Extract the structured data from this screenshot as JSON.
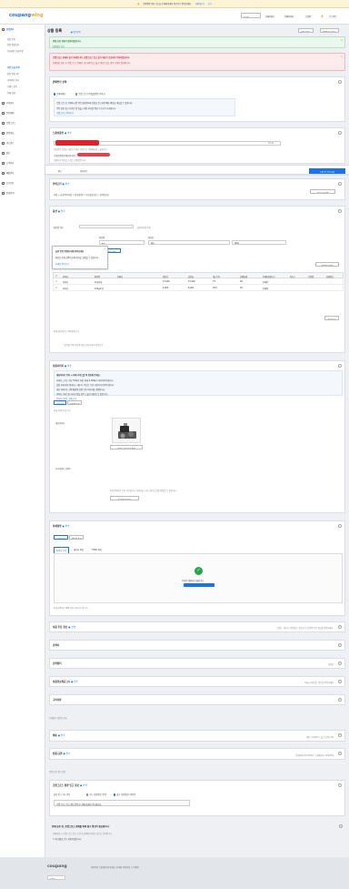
{
  "banner": {
    "text": "쿠팡윙의 주요 기능을 한 페이지에서 바로가기 알아보세요.",
    "link1": "자세히보기",
    "link2": "닫기"
  },
  "topbar": {
    "logo_a": "coupang",
    "logo_b": "wing",
    "lang": "한국어",
    "links": [
      "판매자정보",
      "판매자센터",
      "도움말",
      "로그아웃"
    ]
  },
  "sidebar": {
    "sections": [
      {
        "label": "상품관리",
        "subs": [
          "상품 등록",
          "상품 일괄등록",
          "등록상품 조회/수정",
          "상품 조회/수정",
          "상품 알림 관리",
          "가격관리 관리",
          "브랜드 관리",
          "판매 요청"
        ]
      },
      {
        "label": "가격관리"
      },
      {
        "label": "주문/배송"
      },
      {
        "label": "로켓그로스"
      },
      {
        "label": "반품/취소"
      },
      {
        "label": "광고관리"
      },
      {
        "label": "정산"
      },
      {
        "label": "고객관리"
      },
      {
        "label": "매장관리"
      },
      {
        "label": "프로모션"
      },
      {
        "label": "통계/분석"
      }
    ]
  },
  "page": {
    "title": "상품 등록",
    "subtitle": "● 필수항목",
    "btn1": "판매 가이드",
    "btn2": "상품등록 가이드"
  },
  "alerts": {
    "green_title": "판매 요청 상태가 변경되었습니다.",
    "green_sub": "상품정보 보기",
    "red_title": "로켓그로스 판매가 불가 상태입니다. 로켓그로스 입고 불가 재료가 포함되어 등록되었습니다.",
    "red_sub": "판매요청 검토 후 로켓그로스 판매가 가능하며 입고 불가 재료가 있는 경우 수정이 필요합니다."
  },
  "sales_method": {
    "title": "판매방식 선택",
    "opt1": "판매자배송",
    "opt2": "로켓그로스(쿠팡풀필먼트서비스)",
    "note1": "로켓그로스로 판매하시면 쿠팡 물류센터에 상품을 입고하여 빠른 배송을 제공할 수 있습니다.",
    "note2": "쿠팡 물류 창고 보관료 및 입출고 배송 처리를 위한 수수료가 부과됩니다.",
    "link": "로켓그로스 알아보기"
  },
  "product_name": {
    "title": "노출상품명",
    "req": "● 필수",
    "hint": "상품명은 상품을 식별하기 위한 이름으로 판매채널에 노출됩니다.",
    "count": "4/100",
    "sub": "등록상품명(판매자관리용)",
    "sub_hint": "판매자만 확인할 수 있는 상품명입니다."
  },
  "tabs": {
    "t1": "취소",
    "t2": "미리보기",
    "save": "수정 및 승인 요청"
  },
  "category": {
    "title": "카테고리",
    "req": "● 필수",
    "path": "식품 > 가공/즉석식품 > 통조림/캔 > 수산물통조림 > 참치통조림",
    "btn": "카테고리 변경"
  },
  "options": {
    "title": "옵션",
    "req": "● 필수",
    "field1": "옵션명 개수",
    "field1_val": "1개",
    "field2": "옵션명",
    "field2_val": "중량",
    "field3": "옵션값",
    "field3_val": "1kg",
    "field4_val": "100g",
    "hint": "옵션목록에 적용",
    "popup_title": "옵션 입력 방법에 대해 알아보세요",
    "popup_text": "옵션을 통해 상품의 판매 방식을 설정할 수 있습니다.",
    "popup_link": "자세히 알아보기",
    "popup_btn": "옵션목록 적용",
    "table_title": "옵션목록 (총 2개)",
    "table_btn": "옵션목록 편집",
    "headers": [
      "",
      "이미지",
      "옵션명",
      "판매가",
      "정상가",
      "할인율",
      "재고수량",
      "판매상태",
      "판매자상품코드",
      "바코드",
      "모델명",
      "상세정보"
    ],
    "rows": [
      {
        "img": "이미지",
        "opt": "1kg/1개",
        "price": "13,900",
        "normal": "15,000",
        "dc": "7%",
        "stock": "99",
        "state": "판매중"
      },
      {
        "img": "이미지",
        "opt": "100g/1개",
        "price": "4,900",
        "normal": "6,000",
        "dc": "18%",
        "stock": "99",
        "state": "판매중"
      }
    ],
    "more": "▼ 더보기",
    "note": "최대 옵션개수는 200개입니다.",
    "footer": "* 옵션별 판매 방식에 대한 안내 자세히 알아보기"
  },
  "images": {
    "title": "상품이미지",
    "req": "● 필수",
    "notice_title": "대표이미지 등록 시 아래 가이드를 꼭 확인해 주세요.",
    "notice_lines": [
      "이미지 크기는 최소 500px 이상, 최대 5,000px 이하이어야 합니다.",
      "상품 이미지에 워터마크, 테두리, 텍스트 등이 포함되지 않아야 합니다.",
      "대표 이미지는 흰색 배경의 상품 단독 이미지를 권장합니다.",
      "이미지 가이드를 지키지 않을 경우 노출이 제한될 수 있습니다."
    ],
    "notice_link": "이미지 가이드 전체 보기",
    "tab1": "기본 등록",
    "tab2": "옵션별 등록",
    "size_hint": "최대 10개 등록 가능",
    "main_label": "대표이미지",
    "main_caption": "이미지 1/1 등록 완료",
    "extra_label": "추가이미지 (선택)",
    "extra_hint": "최대 9개까지 등록 가능합니다. 이미지를 드래그해서 순서를 변경할 수 있습니다.",
    "extra_caption": "추가이미지 등록"
  },
  "detail": {
    "title": "상세설명",
    "req": "● 필수",
    "tab1": "기본 등록",
    "tab2": "템플릿 등록",
    "sub1": "이미지 등록",
    "sub2": "에디터 작성",
    "sub3": "HTML 작성",
    "done_text": "등록된 데이터가 있습니다",
    "done_btn": "수정하기",
    "foot": "최대 100개, 5MB 이하 이미지 등록 가능"
  },
  "collapsed": [
    {
      "title": "상품 주요 정보",
      "req": "● 선택",
      "right": "브랜드, 제조사, 인증정보, 원산지 등 상품의 주요 정보를 입력하세요."
    },
    {
      "title": "검색어",
      "req": "",
      "right": ""
    },
    {
      "title": "검색필터",
      "req": "",
      "right": "설정됨"
    },
    {
      "title": "상품정보제공고시",
      "req": "● 필수",
      "right": "카테고리에 맞는 정보를 입력하세요"
    },
    {
      "title": "구비서류",
      "req": "",
      "right": ""
    }
  ],
  "section_note": "판매정보 재입력 안내",
  "shipping": {
    "title": "배송",
    "req": "● 필수",
    "right": "택배 / 무료배송 / 출고소요일 2일"
  },
  "returns": {
    "title": "반품/교환",
    "req": "● 필수",
    "right": "반품배송비 5,000원 / 교환배송비 10,000원"
  },
  "returns_note": "반품/교환 정보 확인",
  "rocket": {
    "title": "로켓그로스 물류 입고 정보",
    "req": "● 선택",
    "label": "물류 입고 가능 여부",
    "opt1": "가능 (상품정보 입력)",
    "opt2": "불가 (상품정보 미입력)",
    "box": "로켓그로스 입고 정보 입력 후 판매 요청이 가능합니다."
  },
  "agreement": {
    "title": "판매 요청 전, 로켓그로스 판매를 위해 필수 확인이 필요합니다.",
    "text": "판매요청 시 로켓그로스 입고 조건 및 정책에 동의한 것으로 간주합니다.",
    "check": "위 내용을 모두 확인하였습니다."
  },
  "footer": {
    "logo": "coupang",
    "lang": "한국어",
    "links": "이용약관 | 개인정보처리방침 | 판매자 이용약관 | 고객센터"
  }
}
